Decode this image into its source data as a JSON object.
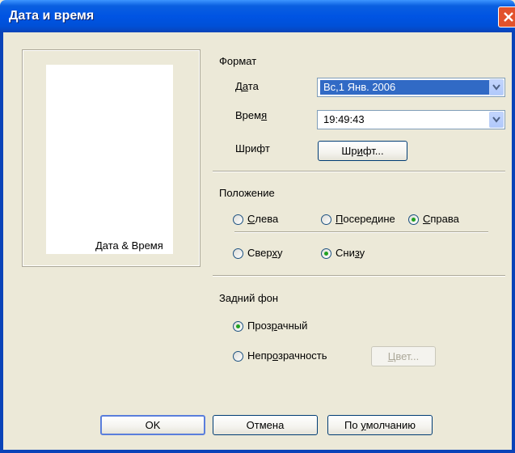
{
  "window": {
    "title": "Дата и время"
  },
  "preview": {
    "text": "Дата & Время"
  },
  "format": {
    "heading": "Формат",
    "date": {
      "label_pre": "Д",
      "label_acc": "а",
      "label_post": "та",
      "value": "Вс,1 Янв. 2006"
    },
    "time": {
      "label_pre": "Врем",
      "label_acc": "я",
      "label_post": "",
      "value": "19:49:43"
    },
    "font": {
      "label": "Шрифт",
      "button_pre": "Шр",
      "button_acc": "и",
      "button_post": "фт..."
    }
  },
  "position": {
    "heading": "Положение",
    "left": {
      "pre": "",
      "acc": "С",
      "post": "лева",
      "selected": false
    },
    "center": {
      "pre": "",
      "acc": "П",
      "post": "осередине",
      "selected": false
    },
    "right": {
      "pre": "",
      "acc": "С",
      "post": "права",
      "selected": true
    },
    "top": {
      "pre": "Свер",
      "acc": "х",
      "post": "у",
      "selected": false
    },
    "bottom": {
      "pre": "Сни",
      "acc": "з",
      "post": "у",
      "selected": true
    }
  },
  "background": {
    "heading": "Задний фон",
    "transparent": {
      "pre": "Проз",
      "acc": "р",
      "post": "ачный",
      "selected": true
    },
    "opaque": {
      "pre": "Непр",
      "acc": "о",
      "post": "зрачность",
      "selected": false
    },
    "color_button": {
      "pre": "",
      "acc": "Ц",
      "post": "вет..."
    }
  },
  "buttons": {
    "ok": "OK",
    "cancel": "Отмена",
    "default": {
      "pre": "По ",
      "acc": "у",
      "post": "молчанию"
    }
  },
  "colors": {
    "titlebar": "#0054e3",
    "face": "#ece9d8",
    "selection": "#316ac5",
    "radio_dot": "#21a121"
  }
}
